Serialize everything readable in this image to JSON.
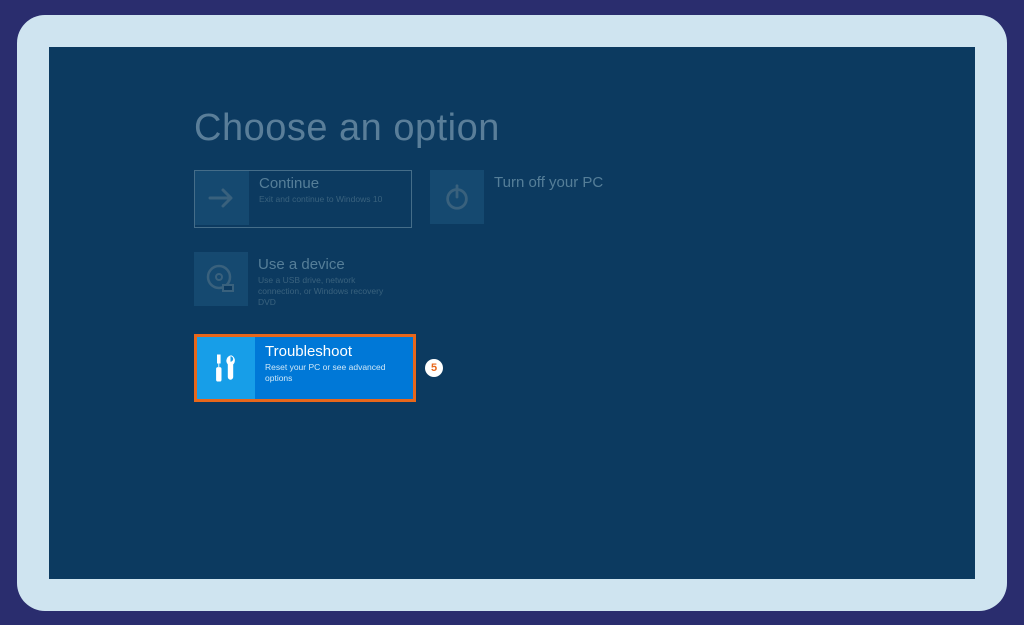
{
  "title": "Choose an option",
  "options": {
    "continue": {
      "label": "Continue",
      "desc": "Exit and continue to Windows 10"
    },
    "turnoff": {
      "label": "Turn off your PC",
      "desc": ""
    },
    "usedevice": {
      "label": "Use a device",
      "desc": "Use a USB drive, network connection, or Windows recovery DVD"
    },
    "troubleshoot": {
      "label": "Troubleshoot",
      "desc": "Reset your PC or see advanced options"
    }
  },
  "step_badge": "5"
}
